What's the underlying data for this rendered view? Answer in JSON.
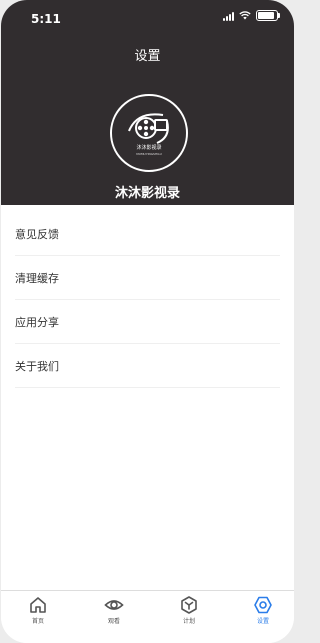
{
  "status_bar": {
    "time": "5:11",
    "battery_level": 0.9
  },
  "header": {
    "title": "设置",
    "app_name": "沐沐影视录",
    "logo_text": "沐沐影视录",
    "logo_subtext": "MUMUYINGSHILU"
  },
  "menu": {
    "items": [
      {
        "label": "意见反馈"
      },
      {
        "label": "清理缓存"
      },
      {
        "label": "应用分享"
      },
      {
        "label": "关于我们"
      }
    ]
  },
  "tabbar": {
    "tabs": [
      {
        "label": "首页",
        "icon": "home-icon"
      },
      {
        "label": "观看",
        "icon": "eye-icon"
      },
      {
        "label": "计划",
        "icon": "plan-icon"
      },
      {
        "label": "设置",
        "icon": "settings-icon",
        "active": true
      }
    ],
    "active_color": "#2b7de9"
  },
  "colors": {
    "header_bg": "#312d2f",
    "accent": "#2b7de9"
  }
}
